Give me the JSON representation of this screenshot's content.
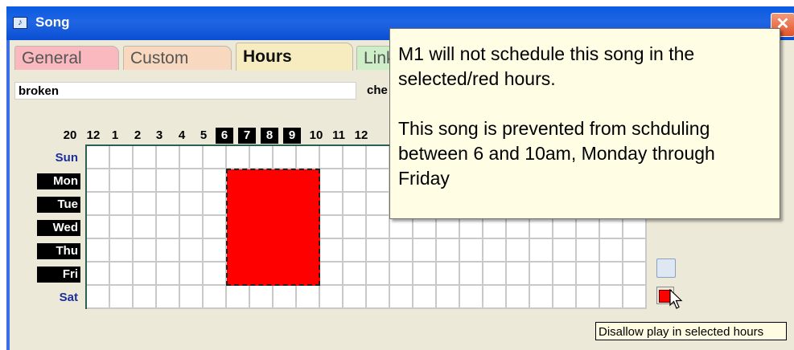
{
  "window": {
    "title": "Song",
    "close_glyph": "✕"
  },
  "tabs": [
    {
      "label": "General",
      "active": false,
      "color": "#f9b9be"
    },
    {
      "label": "Custom",
      "active": false,
      "color": "#f8d9bf"
    },
    {
      "label": "Hours",
      "active": true,
      "color": "#f6ecbf"
    },
    {
      "label": "Link",
      "active": false,
      "color": "#cdeec7"
    }
  ],
  "fields": {
    "song_name": "broken",
    "other_label": "che"
  },
  "grid": {
    "hour_labels": [
      "20",
      "12",
      "1",
      "2",
      "3",
      "4",
      "5",
      "6",
      "7",
      "8",
      "9",
      "10",
      "11",
      "12"
    ],
    "highlighted_hours": [
      "6",
      "7",
      "8",
      "9"
    ],
    "days": [
      {
        "label": "Sun",
        "style": "plain"
      },
      {
        "label": "Mon",
        "style": "inverse"
      },
      {
        "label": "Tue",
        "style": "inverse"
      },
      {
        "label": "Wed",
        "style": "inverse"
      },
      {
        "label": "Thu",
        "style": "inverse"
      },
      {
        "label": "Fri",
        "style": "inverse"
      },
      {
        "label": "Sat",
        "style": "plain"
      }
    ],
    "blocked_color": "#ff0000"
  },
  "tooltip": {
    "text": "Disallow play in selected hours"
  },
  "callout": {
    "line1": "M1 will not schedule this song in the selected/red hours.",
    "line2": "This song is prevented from schduling between 6 and 10am, Monday through Friday"
  },
  "icons": [
    "song-window-icon",
    "close-icon",
    "pointer-cursor-icon",
    "disallow-hours-icon"
  ]
}
